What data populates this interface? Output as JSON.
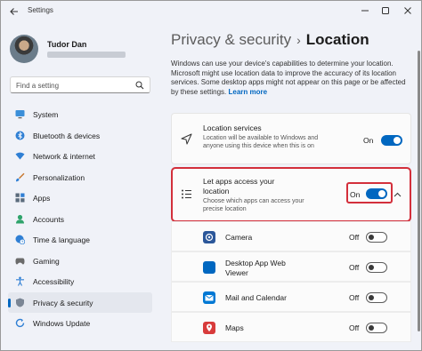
{
  "window": {
    "title": "Settings"
  },
  "profile": {
    "name": "Tudor Dan"
  },
  "search": {
    "placeholder": "Find a setting"
  },
  "sidebar": {
    "items": [
      {
        "label": "System",
        "icon": "monitor-icon"
      },
      {
        "label": "Bluetooth & devices",
        "icon": "bluetooth-icon"
      },
      {
        "label": "Network & internet",
        "icon": "wifi-icon"
      },
      {
        "label": "Personalization",
        "icon": "brush-icon"
      },
      {
        "label": "Apps",
        "icon": "apps-icon"
      },
      {
        "label": "Accounts",
        "icon": "person-icon"
      },
      {
        "label": "Time & language",
        "icon": "globe-clock-icon"
      },
      {
        "label": "Gaming",
        "icon": "gamepad-icon"
      },
      {
        "label": "Accessibility",
        "icon": "accessibility-icon"
      },
      {
        "label": "Privacy & security",
        "icon": "shield-icon",
        "active": true
      },
      {
        "label": "Windows Update",
        "icon": "update-icon"
      }
    ]
  },
  "breadcrumb": {
    "parent": "Privacy & security",
    "separator": "›",
    "current": "Location"
  },
  "description": {
    "text": "Windows can use your device's capabilities to determine your location. Microsoft might use location data to improve the accuracy of its location services. Some desktop apps might not appear on this page or be affected by these settings.",
    "link": "Learn more"
  },
  "location_services": {
    "title": "Location services",
    "subtitle": "Location will be available to Windows and anyone using this device when this is on",
    "state": "On",
    "enabled": true
  },
  "let_apps_access": {
    "title": "Let apps access your location",
    "subtitle": "Choose which apps can access your precise location",
    "state": "On",
    "enabled": true,
    "expanded": true
  },
  "apps": [
    {
      "name": "Camera",
      "state": "Off",
      "enabled": false,
      "color": "#2b579a"
    },
    {
      "name": "Desktop App Web Viewer",
      "state": "Off",
      "enabled": false,
      "color": "#0067c0"
    },
    {
      "name": "Mail and Calendar",
      "state": "Off",
      "enabled": false,
      "color": "#0078d4"
    },
    {
      "name": "Maps",
      "state": "Off",
      "enabled": false,
      "color": "#d83b3b"
    }
  ],
  "colors": {
    "accent": "#0067c0",
    "highlight": "#d32f3b"
  }
}
